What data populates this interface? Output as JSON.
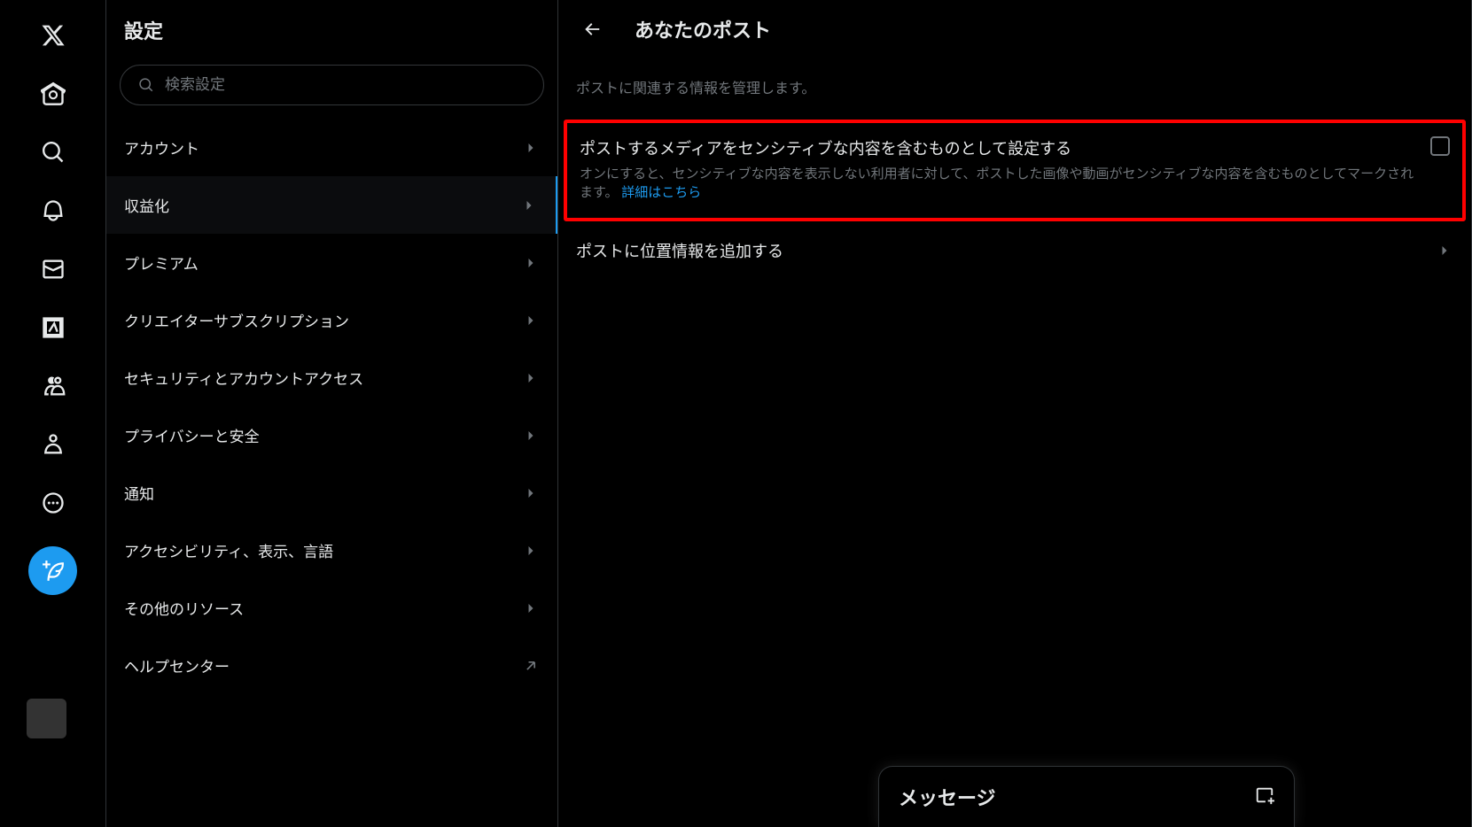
{
  "settings": {
    "title": "設定",
    "search_placeholder": "検索設定",
    "menu": [
      {
        "label": "アカウント"
      },
      {
        "label": "収益化"
      },
      {
        "label": "プレミアム"
      },
      {
        "label": "クリエイターサブスクリプション"
      },
      {
        "label": "セキュリティとアカウントアクセス"
      },
      {
        "label": "プライバシーと安全"
      },
      {
        "label": "通知"
      },
      {
        "label": "アクセシビリティ、表示、言語"
      },
      {
        "label": "その他のリソース"
      },
      {
        "label": "ヘルプセンター"
      }
    ]
  },
  "detail": {
    "title": "あなたのポスト",
    "subtitle": "ポストに関連する情報を管理します。",
    "sensitive_option": {
      "title": "ポストするメディアをセンシティブな内容を含むものとして設定する",
      "description": "オンにすると、センシティブな内容を表示しない利用者に対して、ポストした画像や動画がセンシティブな内容を含むものとしてマークされます。",
      "link_text": "詳細はこちら"
    },
    "location_option": "ポストに位置情報を追加する"
  },
  "messages": {
    "title": "メッセージ"
  }
}
